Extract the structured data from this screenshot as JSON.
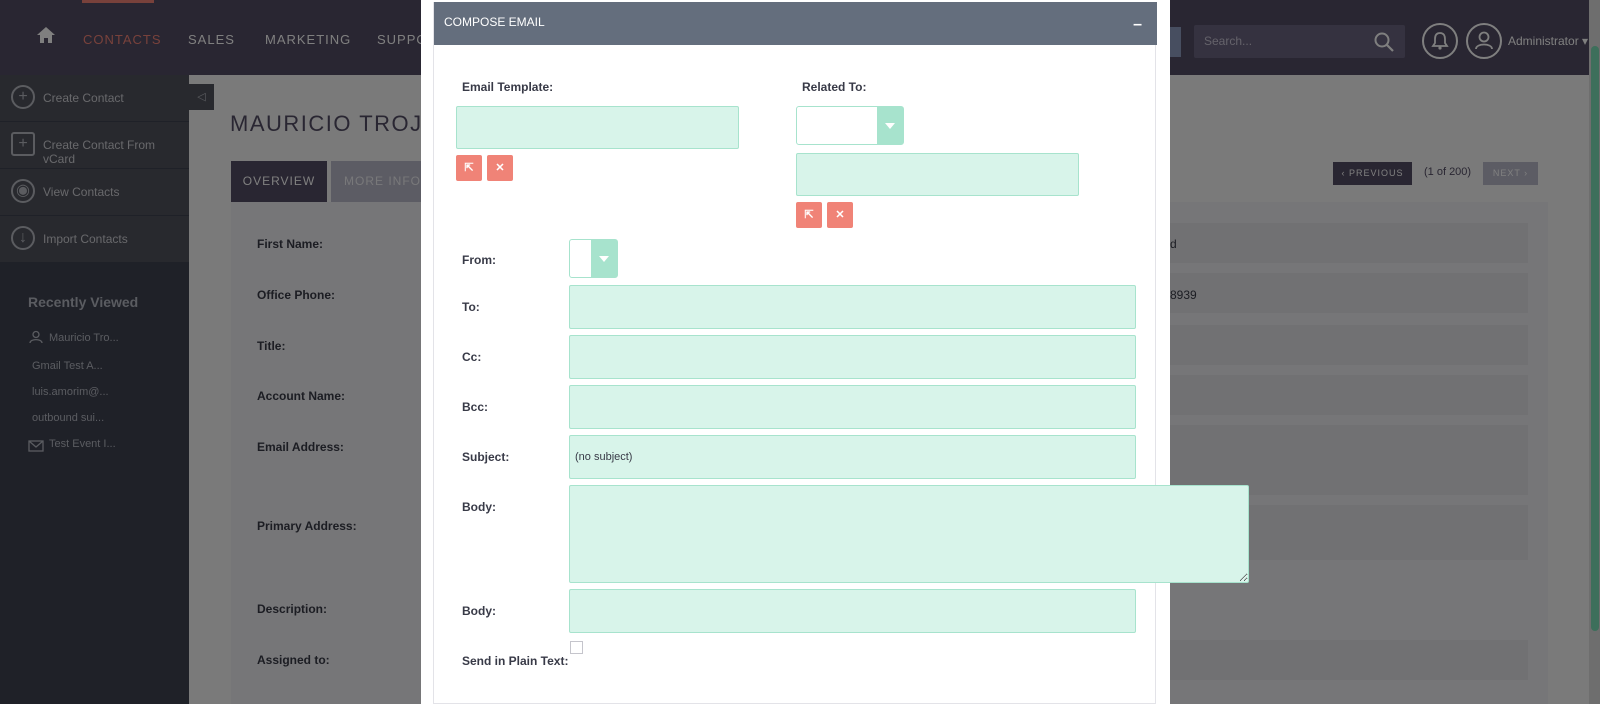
{
  "nav": {
    "items": [
      {
        "label": "CONTACTS",
        "active": true
      },
      {
        "label": "SALES"
      },
      {
        "label": "MARKETING"
      },
      {
        "label": "SUPPO"
      }
    ],
    "search_placeholder": "Search...",
    "user_label": "Administrator",
    "active_color": "#f08377",
    "bg_color": "#534d64"
  },
  "sidebar": {
    "actions": [
      {
        "label": "Create Contact",
        "icon": "plus-circle-icon"
      },
      {
        "label": "Create Contact From vCard",
        "icon": "vcard-plus-icon"
      },
      {
        "label": "View Contacts",
        "icon": "eye-icon"
      },
      {
        "label": "Import Contacts",
        "icon": "download-icon"
      }
    ],
    "recent_title": "Recently Viewed",
    "recent_items": [
      {
        "label": "Mauricio Tro...",
        "icon": "person-icon"
      },
      {
        "label": "Gmail Test A..."
      },
      {
        "label": "luis.amorim@..."
      },
      {
        "label": "outbound sui..."
      },
      {
        "label": "Test Event I...",
        "icon": "envelope-icon"
      }
    ]
  },
  "record": {
    "title": "MAURICIO TROJ",
    "tabs": [
      "OVERVIEW",
      "MORE INFO"
    ],
    "pager": {
      "prev": "PREVIOUS",
      "count": "(1 of 200)",
      "next": "NEXT"
    },
    "fields": [
      "First Name:",
      "Office Phone:",
      "Title:",
      "Account Name:",
      "Email Address:",
      "Primary Address:",
      "Description:",
      "Assigned to:"
    ],
    "values": [
      "d",
      "8939"
    ]
  },
  "modal": {
    "title": "COMPOSE EMAIL",
    "minimize": "–",
    "labels": {
      "email_template": "Email Template:",
      "related_to": "Related To:",
      "from": "From:",
      "to": "To:",
      "cc": "Cc:",
      "bcc": "Bcc:",
      "subject": "Subject:",
      "body": "Body:",
      "body2": "Body:",
      "plain_text": "Send in Plain Text:"
    },
    "subject_value": "(no subject)",
    "input_color": "#d8f4ea",
    "button_color": "#f08377"
  }
}
